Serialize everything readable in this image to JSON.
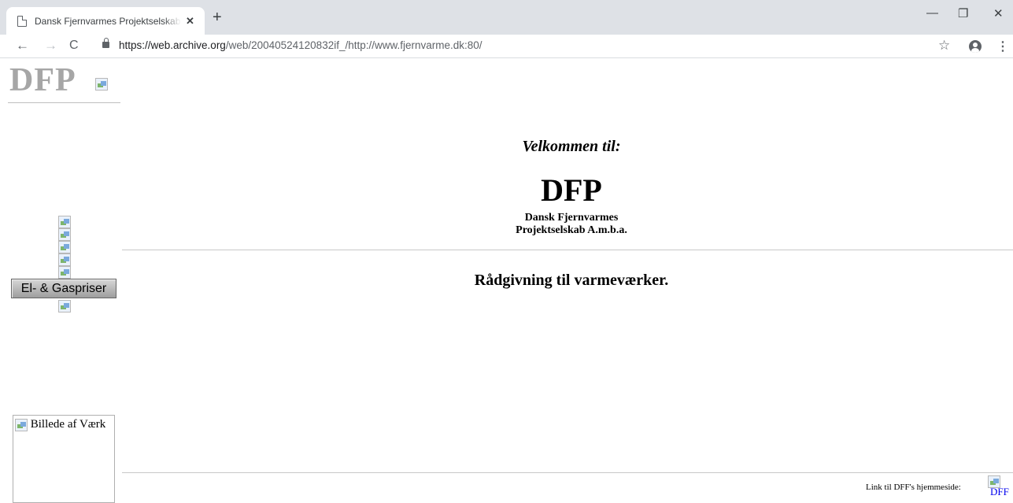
{
  "browser": {
    "tab_title": "Dansk Fjernvarmes Projektselskab A.m.b.a.",
    "tab_close": "✕",
    "new_tab": "+",
    "url_host": "https://web.archive.org",
    "url_path": "/web/20040524120832if_/http://www.fjernvarme.dk:80/",
    "back": "←",
    "forward": "→",
    "reload": "C",
    "star": "☆",
    "menu": "⋮",
    "minimize": "—",
    "restore": "❐",
    "close": "✕"
  },
  "page": {
    "logo_text": "DFP",
    "nav_button": "El- & Gaspriser",
    "welcome": "Velkommen til:",
    "title": "DFP",
    "subtitle_line1": "Dansk Fjernvarmes",
    "subtitle_line2": "Projektselskab A.m.b.a.",
    "tagline": "Rådgivning til varmeværker.",
    "photo_alt": "Billede af Værk",
    "footer_text": "Link til DFF's hjemmeside:",
    "footer_link": "DFF"
  }
}
